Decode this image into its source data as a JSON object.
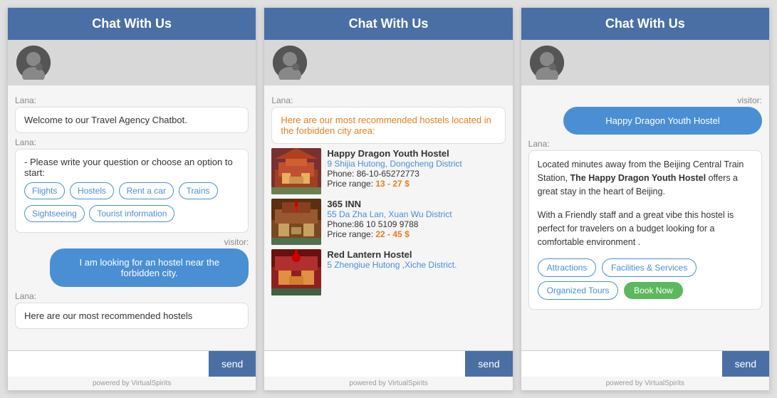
{
  "header": {
    "title": "Chat With Us"
  },
  "poweredBy": "powered by VirtualSpirits",
  "sendLabel": "send",
  "panels": [
    {
      "id": "panel1",
      "lana_greeting": "Welcome to our Travel Agency Chatbot.",
      "lana_prompt": "- Please write your question or choose an option to start:",
      "options": [
        "Flights",
        "Hostels",
        "Rent a car",
        "Trains",
        "Sightseeing",
        "Tourist information"
      ],
      "visitor_msg": "I am looking for an hostel near the forbidden city.",
      "lana_partial": "Here are our most recommended hostels"
    },
    {
      "id": "panel2",
      "lana_intro": "Here are our most recommended hostels located in the forbidden city area:",
      "hostels": [
        {
          "name": "Happy Dragon Youth Hostel",
          "address": "9 Shijia Hutong, Dongcheng District",
          "phone": "Phone: 86-10-65272773",
          "price": "Price range:",
          "price_value": "13 - 27 $",
          "color1": "#8B2020",
          "color2": "#B85C00"
        },
        {
          "name": "365 INN",
          "address": "55 Da Zha Lan, Xuan Wu District",
          "phone": "Phone:86 10 5109 9788",
          "price": "Price range:",
          "price_value": "22 - 45 $",
          "color1": "#5C3317",
          "color2": "#8B6914"
        },
        {
          "name": "Red Lantern Hostel",
          "address": "5 Zhengiue Hutong ,Xiche District.",
          "phone": "",
          "price": "",
          "price_value": "",
          "color1": "#B22222",
          "color2": "#8B4513"
        }
      ]
    },
    {
      "id": "panel3",
      "visitor_msg": "Happy Dragon Youth Hostel",
      "lana_desc1": "Located minutes away from the Beijing Central Train Station,",
      "lana_bold": "The Happy Dragon Youth Hostel",
      "lana_desc2": " offers a great stay in the heart of Beijing.",
      "lana_desc3": "With a Friendly staff and a great vibe this hostel is perfect for travelers on a budget looking for a comfortable environment .",
      "action_btns": [
        "Attractions",
        "Facilities & Services",
        "Organized Tours"
      ],
      "book_btn": "Book Now"
    }
  ]
}
